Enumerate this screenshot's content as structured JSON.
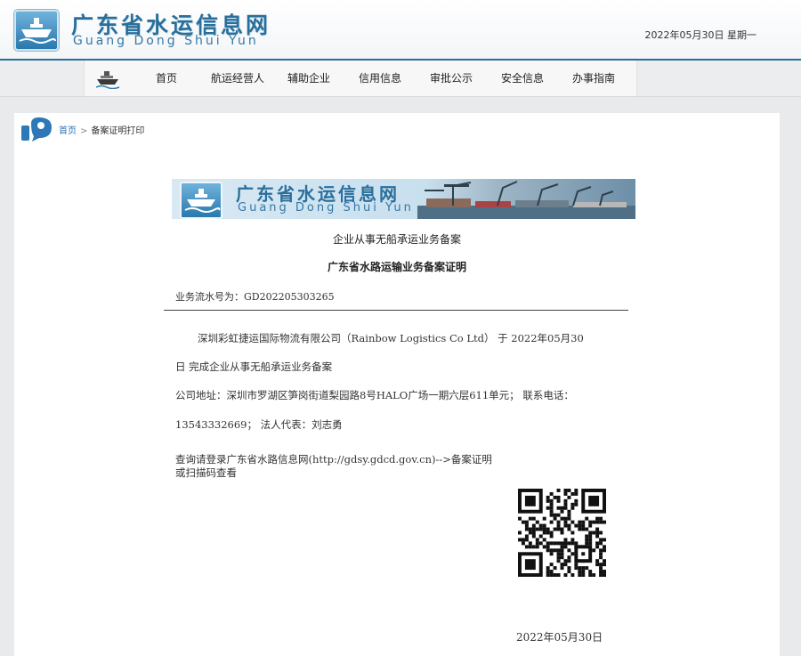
{
  "header": {
    "title": "广东省水运信息网",
    "subtitle": "Guang Dong Shui Yun",
    "date": "2022年05月30日  星期一",
    "logo_icon": "ship-logo-icon"
  },
  "nav": {
    "items": [
      {
        "label": "首页"
      },
      {
        "label": "航运经营人"
      },
      {
        "label": "辅助企业"
      },
      {
        "label": "信用信息"
      },
      {
        "label": "审批公示"
      },
      {
        "label": "安全信息"
      },
      {
        "label": "办事指南"
      }
    ]
  },
  "breadcrumb": {
    "home": "首页",
    "separator": ">",
    "current": "备案证明打印"
  },
  "banner": {
    "title": "广东省水运信息网",
    "subtitle": "Guang Dong Shui Yun"
  },
  "certificate": {
    "type": "企业从事无船承运业务备案",
    "title": "广东省水路运输业务备案证明",
    "serial": "业务流水号为：GD202205303265",
    "line1": "深圳彩虹捷运国际物流有限公司（Rainbow Logistics Co Ltd） 于 2022年05月30",
    "line2": "日 完成企业从事无船承运业务备案",
    "line3": "公司地址：深圳市罗湖区笋岗街道梨园路8号HALO广场一期六层611单元； 联系电话：",
    "line4": "13543332669； 法人代表：刘志勇",
    "query_line1": "查询请登录广东省水路信息网(http://gdsy.gdcd.gov.cn)-->备案证明",
    "query_line2": "或扫描码查看",
    "date": "2022年05月30日"
  },
  "colors": {
    "brand_blue": "#2a6f9b",
    "header_border": "#2c6f94",
    "link": "#2b6fb0"
  }
}
